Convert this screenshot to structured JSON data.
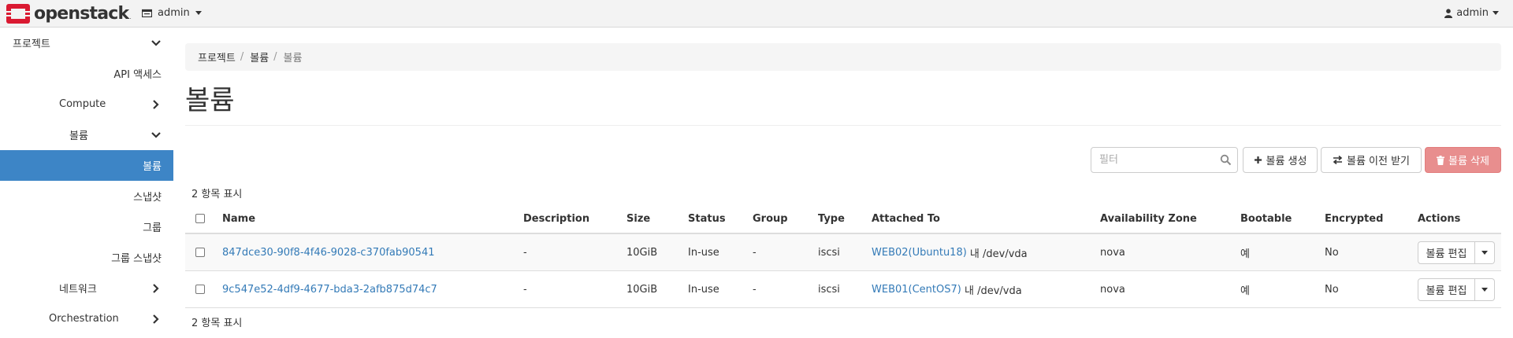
{
  "brand": {
    "name": "openstack",
    "reg_mark": "."
  },
  "navbar": {
    "project_label": "admin",
    "user_label": "admin"
  },
  "sidebar": {
    "items": [
      {
        "label": "프로젝트"
      },
      {
        "label": "API 액세스"
      },
      {
        "label": "Compute"
      },
      {
        "label": "볼륨"
      },
      {
        "label": "볼륨"
      },
      {
        "label": "스냅샷"
      },
      {
        "label": "그룹"
      },
      {
        "label": "그룹 스냅샷"
      },
      {
        "label": "네트워크"
      },
      {
        "label": "Orchestration"
      }
    ]
  },
  "breadcrumb": {
    "items": [
      "프로젝트",
      "볼륨",
      "볼륨"
    ],
    "separator": "/"
  },
  "page": {
    "title": "볼륨"
  },
  "toolbar": {
    "filter_placeholder": "필터",
    "create_label": "볼륨 생성",
    "accept_transfer_label": "볼륨 이전 받기",
    "delete_label": "볼륨 삭제"
  },
  "count_text": "2 항목 표시",
  "table": {
    "columns": [
      "Name",
      "Description",
      "Size",
      "Status",
      "Group",
      "Type",
      "Attached To",
      "Availability Zone",
      "Bootable",
      "Encrypted",
      "Actions"
    ],
    "rows": [
      {
        "name": "847dce30-90f8-4f46-9028-c370fab90541",
        "description": "-",
        "size": "10GiB",
        "status": "In-use",
        "group": "-",
        "type": "iscsi",
        "attached_link": "WEB02(Ubuntu18)",
        "attached_rest": " 내 /dev/vda",
        "availability_zone": "nova",
        "bootable": "예",
        "encrypted": "No",
        "action_label": "볼륨 편집"
      },
      {
        "name": "9c547e52-4df9-4677-bda3-2afb875d74c7",
        "description": "-",
        "size": "10GiB",
        "status": "In-use",
        "group": "-",
        "type": "iscsi",
        "attached_link": "WEB01(CentOS7)",
        "attached_rest": " 내 /dev/vda",
        "availability_zone": "nova",
        "bootable": "예",
        "encrypted": "No",
        "action_label": "볼륨 편집"
      }
    ]
  },
  "colors": {
    "active_nav": "#3d85c6",
    "link": "#337ab7",
    "danger_button": "#e88e8e",
    "brand_red": "#da1a32"
  }
}
